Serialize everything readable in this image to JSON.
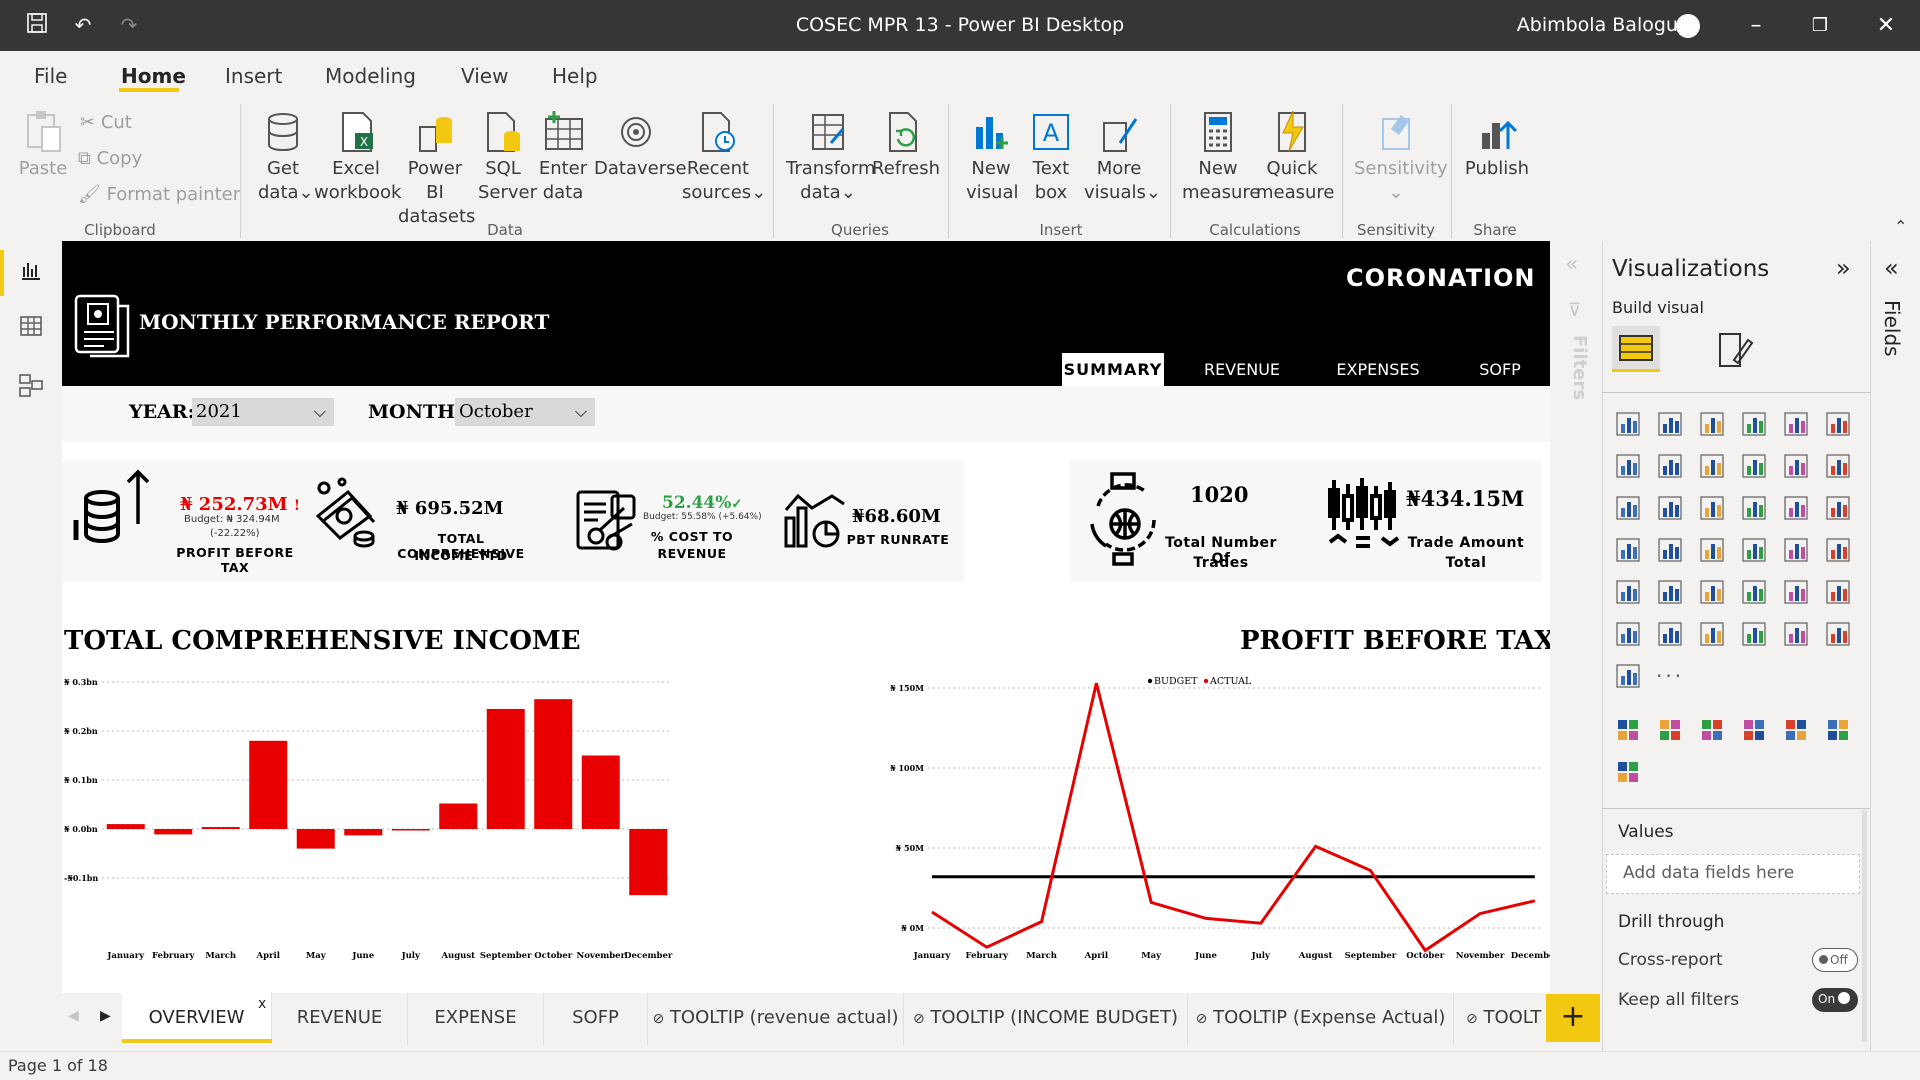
{
  "window": {
    "title": "COSEC MPR 13 - Power BI Desktop",
    "user": "Abimbola Balogun"
  },
  "menu": [
    "File",
    "Home",
    "Insert",
    "Modeling",
    "View",
    "Help"
  ],
  "ribbon": {
    "clipboard": {
      "paste": "Paste",
      "cut": "Cut",
      "copy": "Copy",
      "format_painter": "Format painter",
      "group": "Clipboard"
    },
    "data": {
      "get_data": [
        "Get",
        "data"
      ],
      "excel": [
        "Excel",
        "workbook"
      ],
      "pbi_datasets": [
        "Power BI",
        "datasets"
      ],
      "sql": [
        "SQL",
        "Server"
      ],
      "enter_data": [
        "Enter",
        "data"
      ],
      "dataverse": [
        "Dataverse",
        ""
      ],
      "recent": [
        "Recent",
        "sources"
      ],
      "group": "Data"
    },
    "queries": {
      "transform": [
        "Transform",
        "data"
      ],
      "refresh": [
        "Refresh",
        ""
      ],
      "group": "Queries"
    },
    "insert": {
      "new_visual": [
        "New",
        "visual"
      ],
      "text_box": [
        "Text",
        "box"
      ],
      "more_visuals": [
        "More",
        "visuals"
      ],
      "group": "Insert"
    },
    "calculations": {
      "new_measure": [
        "New",
        "measure"
      ],
      "quick_measure": [
        "Quick",
        "measure"
      ],
      "group": "Calculations"
    },
    "sensitivity": {
      "label": "Sensitivity",
      "group": "Sensitivity"
    },
    "share": {
      "publish": "Publish",
      "group": "Share"
    }
  },
  "report": {
    "title": "MONTHLY PERFORMANCE REPORT",
    "brand": "CORONATION",
    "nav": [
      "SUMMARY",
      "REVENUE",
      "EXPENSES",
      "SOFP"
    ],
    "filters": {
      "year_label": "YEAR:",
      "year_value": "2021",
      "month_label": "MONTH:",
      "month_value": "October"
    },
    "kpis": {
      "pbt": {
        "value": "₦ 252.73M",
        "flag": "!",
        "budget": "Budget: ₦ 324.94M",
        "variance": "(-22.22%)",
        "label": "PROFIT BEFORE TAX"
      },
      "tci": {
        "value": "₦ 695.52M",
        "label": [
          "TOTAL COMPREHENSIVE",
          "INCOME YTD"
        ]
      },
      "ctr": {
        "value": "52.44%",
        "check": "✓",
        "budget": "Budget: 55.58% (+5.64%)",
        "label": [
          "% COST TO",
          "REVENUE"
        ]
      },
      "runrate": {
        "value": "₦68.60M",
        "label": "PBT RUNRATE"
      },
      "trades": {
        "value": "1020",
        "label": [
          "Total Number Of",
          "Trades"
        ]
      },
      "trade_amount": {
        "value": "₦434.15M",
        "label": [
          "Trade Amount",
          "Total"
        ]
      }
    }
  },
  "chart_data": [
    {
      "type": "bar",
      "title": "TOTAL COMPREHENSIVE INCOME",
      "categories": [
        "January",
        "February",
        "March",
        "April",
        "May",
        "June",
        "July",
        "August",
        "September",
        "October",
        "November",
        "December"
      ],
      "values": [
        0.01,
        -0.011,
        0.004,
        0.18,
        -0.04,
        -0.013,
        -0.002,
        0.052,
        0.245,
        0.265,
        0.15,
        -0.135
      ],
      "yticks": [
        "₦ 0.3bn",
        "₦ 0.2bn",
        "₦ 0.1bn",
        "₦ 0.0bn",
        "-₦0.1bn"
      ],
      "ytick_values": [
        0.3,
        0.2,
        0.1,
        0.0,
        -0.1
      ],
      "ylim": [
        -0.1,
        0.3
      ],
      "color": "#e80000"
    },
    {
      "type": "line",
      "title": "PROFIT BEFORE TAX",
      "categories": [
        "January",
        "February",
        "March",
        "April",
        "May",
        "June",
        "July",
        "August",
        "September",
        "October",
        "November",
        "December"
      ],
      "legend": [
        "BUDGET",
        "ACTUAL"
      ],
      "series": [
        {
          "name": "BUDGET",
          "color": "#000000",
          "values": [
            32,
            32,
            32,
            32,
            32,
            32,
            32,
            32,
            32,
            32,
            32,
            32
          ]
        },
        {
          "name": "ACTUAL",
          "color": "#e80000",
          "values": [
            10,
            -12,
            4,
            153,
            16,
            6,
            3,
            51,
            36,
            -14,
            9,
            17
          ]
        }
      ],
      "yticks": [
        "₦ 150M",
        "₦ 100M",
        "₦ 50M",
        "₦ 0M"
      ],
      "ytick_values": [
        150,
        100,
        50,
        0
      ],
      "ylim": [
        -20,
        155
      ]
    }
  ],
  "visualizations": {
    "title": "Visualizations",
    "build": "Build visual",
    "values": "Values",
    "values_placeholder": "Add data fields here",
    "drill": "Drill through",
    "cross_report": "Cross-report",
    "cross_state": "Off",
    "keep_filters": "Keep all filters",
    "keep_state": "On",
    "filters_label": "Filters",
    "fields_label": "Fields",
    "more": "···"
  },
  "pages": [
    "OVERVIEW",
    "REVENUE",
    "EXPENSE",
    "SOFP",
    "TOOLTIP (revenue actual)",
    "TOOLTIP (INCOME BUDGET)",
    "TOOLTIP (Expense Actual)",
    "TOOLT"
  ],
  "status": "Page 1 of 18"
}
